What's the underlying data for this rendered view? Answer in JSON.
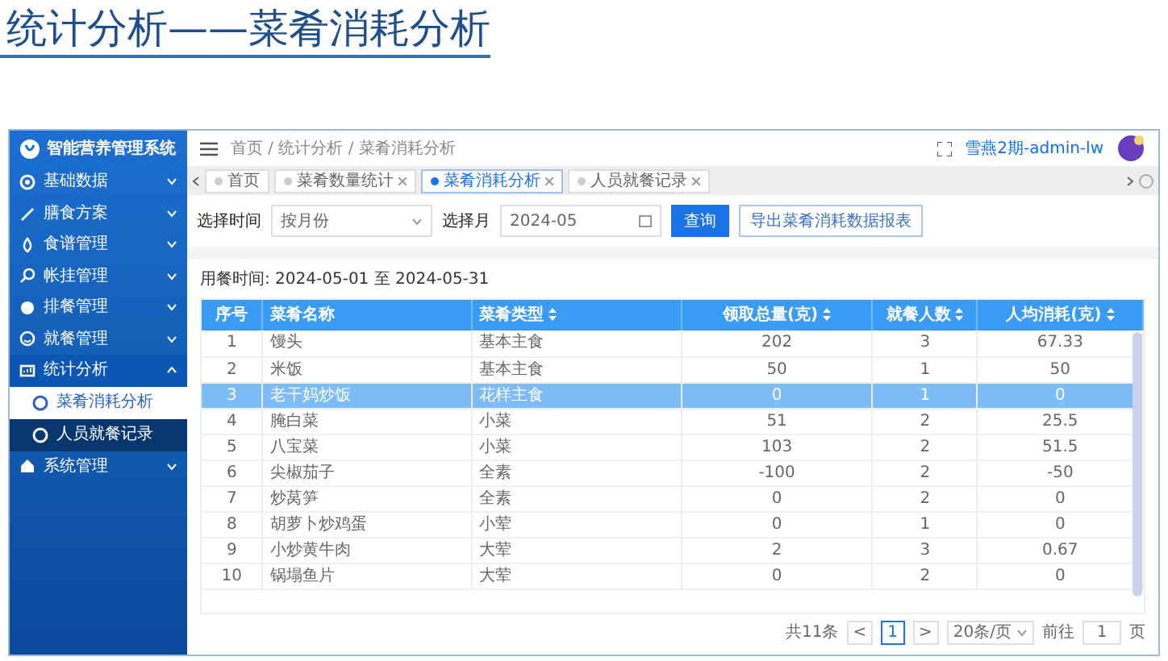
{
  "slide_title": "统计分析——菜肴消耗分析",
  "app": {
    "logo_text": "智能营养管理系统",
    "sidebar": [
      {
        "label": "基础数据",
        "expanded": false
      },
      {
        "label": "膳食方案",
        "expanded": false
      },
      {
        "label": "食谱管理",
        "expanded": false
      },
      {
        "label": "帐挂管理",
        "expanded": false
      },
      {
        "label": "排餐管理",
        "expanded": false
      },
      {
        "label": "就餐管理",
        "expanded": false
      },
      {
        "label": "统计分析",
        "expanded": true,
        "children": [
          {
            "label": "菜肴消耗分析",
            "selected": true
          },
          {
            "label": "人员就餐记录",
            "selected": false
          }
        ]
      },
      {
        "label": "系统管理",
        "expanded": false
      }
    ],
    "breadcrumb": "首页 / 统计分析 / 菜肴消耗分析",
    "user": "雪燕2期-admin-lw",
    "tabs": [
      {
        "label": "首页",
        "selected": false,
        "closable": false
      },
      {
        "label": "菜肴数量统计",
        "selected": false,
        "closable": true
      },
      {
        "label": "菜肴消耗分析",
        "selected": true,
        "closable": true
      },
      {
        "label": "人员就餐记录",
        "selected": false,
        "closable": true
      }
    ],
    "filters": {
      "time_label": "选择时间",
      "time_value": "按月份",
      "month_label": "选择月",
      "month_value": "2024-05",
      "query_button": "查询",
      "export_button": "导出菜肴消耗数据报表"
    },
    "period": "用餐时间: 2024-05-01 至 2024-05-31",
    "table": {
      "columns": [
        {
          "label": "序号",
          "sortable": false
        },
        {
          "label": "菜肴名称",
          "sortable": false
        },
        {
          "label": "菜肴类型",
          "sortable": true
        },
        {
          "label": "领取总量(克)",
          "sortable": true
        },
        {
          "label": "就餐人数",
          "sortable": true
        },
        {
          "label": "人均消耗(克)",
          "sortable": true
        }
      ],
      "rows": [
        {
          "cells": [
            "1",
            "馒头",
            "基本主食",
            "202",
            "3",
            "67.33"
          ],
          "selected": false
        },
        {
          "cells": [
            "2",
            "米饭",
            "基本主食",
            "50",
            "1",
            "50"
          ],
          "selected": false
        },
        {
          "cells": [
            "3",
            "老干妈炒饭",
            "花样主食",
            "0",
            "1",
            "0"
          ],
          "selected": true
        },
        {
          "cells": [
            "4",
            "腌白菜",
            "小菜",
            "51",
            "2",
            "25.5"
          ],
          "selected": false
        },
        {
          "cells": [
            "5",
            "八宝菜",
            "小菜",
            "103",
            "2",
            "51.5"
          ],
          "selected": false
        },
        {
          "cells": [
            "6",
            "尖椒茄子",
            "全素",
            "-100",
            "2",
            "-50"
          ],
          "selected": false
        },
        {
          "cells": [
            "7",
            "炒莴笋",
            "全素",
            "0",
            "2",
            "0"
          ],
          "selected": false
        },
        {
          "cells": [
            "8",
            "胡萝卜炒鸡蛋",
            "小荤",
            "0",
            "1",
            "0"
          ],
          "selected": false
        },
        {
          "cells": [
            "9",
            "小炒黄牛肉",
            "大荤",
            "2",
            "3",
            "0.67"
          ],
          "selected": false
        },
        {
          "cells": [
            "10",
            "锅塌鱼片",
            "大荤",
            "0",
            "2",
            "0"
          ],
          "selected": false
        }
      ]
    },
    "pagination": {
      "total": "共11条",
      "prev": "<",
      "page": "1",
      "next": ">",
      "page_size": "20条/页",
      "goto_label": "前往",
      "goto_value": "1",
      "goto_unit": "页"
    }
  }
}
